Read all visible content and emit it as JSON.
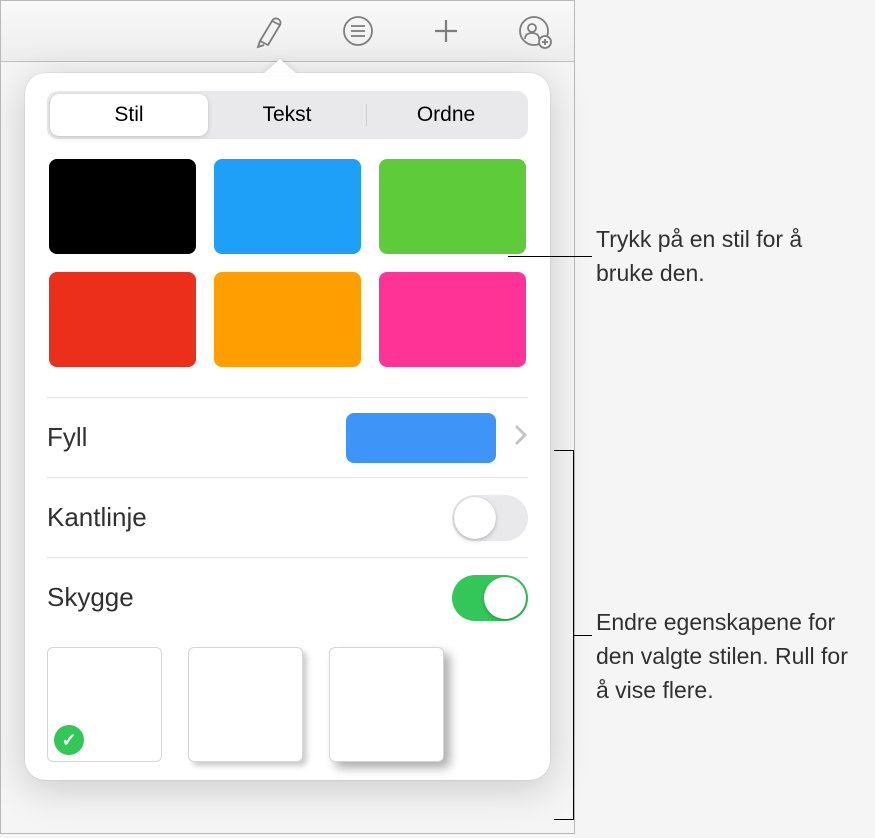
{
  "toolbar": {
    "icons": [
      "format-icon",
      "list-icon",
      "insert-icon",
      "collaborate-icon"
    ]
  },
  "tabs": {
    "style": "Stil",
    "text": "Tekst",
    "arrange": "Ordne"
  },
  "style_swatches": [
    {
      "color": "#000000"
    },
    {
      "color": "#1ea0f9"
    },
    {
      "color": "#5ecb3b"
    },
    {
      "color": "#eb2f1a"
    },
    {
      "color": "#ff9e00"
    },
    {
      "color": "#ff3396"
    }
  ],
  "properties": {
    "fill": {
      "label": "Fyll",
      "color": "#3e95f7"
    },
    "border": {
      "label": "Kantlinje",
      "on": false
    },
    "shadow": {
      "label": "Skygge",
      "on": true
    }
  },
  "shadow_presets": [
    {
      "selected": true
    },
    {
      "selected": false
    },
    {
      "selected": false
    }
  ],
  "callouts": {
    "style_tap": "Trykk på en stil for å bruke den.",
    "properties_scroll": "Endre egenskapene for den valgte stilen. Rull for å vise flere."
  }
}
